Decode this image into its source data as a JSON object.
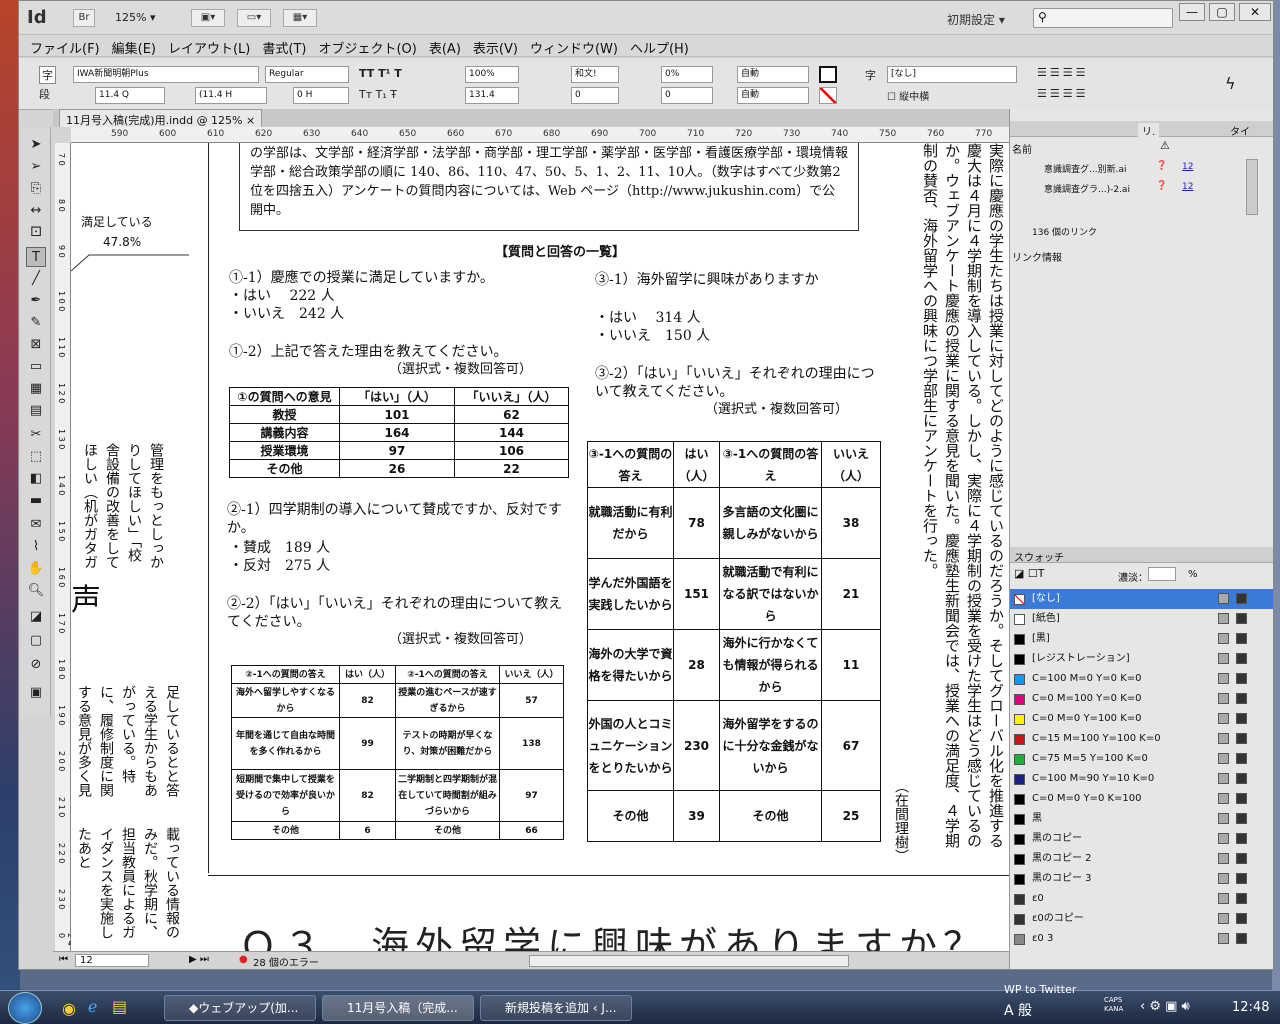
{
  "app": {
    "logo": "Id",
    "bridge": "Br",
    "zoom": "125%",
    "workspace": "初期設定",
    "window_buttons": [
      "—",
      "▢",
      "✕"
    ]
  },
  "menu": [
    "ファイル(F)",
    "編集(E)",
    "レイアウト(L)",
    "書式(T)",
    "オブジェクト(O)",
    "表(A)",
    "表示(V)",
    "ウィンドウ(W)",
    "ヘルプ(H)"
  ],
  "control": {
    "char_icon": "字",
    "para_icon": "段",
    "font": "IWA新聞明朝Plus",
    "style": "Regular",
    "size": "11.4 Q",
    "leading": "(11.4 H",
    "baseline": "0 H",
    "hscale": "100%",
    "vscale": "131.4",
    "tracking_lang": "和文!",
    "tsume": "0%",
    "kerning": "0",
    "spacing": "0",
    "auto1": "自動",
    "auto2": "自動",
    "style_none": "[なし]",
    "tate": "縦中横"
  },
  "doc_tab": "11月号入稿(完成)用.indd @ 125%",
  "ruler_h": [
    "590",
    "600",
    "610",
    "620",
    "630",
    "640",
    "650",
    "660",
    "670",
    "680",
    "690",
    "700",
    "710",
    "720",
    "730",
    "740",
    "750",
    "760",
    "770"
  ],
  "ruler_v": [
    "7 0",
    "8 0",
    "9 0",
    "1 0 0",
    "1 1 0",
    "1 2 0",
    "1 3 0",
    "1 4 0",
    "1 5 0",
    "1 6 0",
    "1 7 0",
    "1 8 0",
    "1 9 0",
    "2 0 0",
    "2 1 0",
    "2 2 0",
    "2 3 0",
    "2 4 0"
  ],
  "status": {
    "page": "12",
    "errors": "28 個のエラー"
  },
  "canvas": {
    "left_chart_label": "満足している",
    "left_chart_pct": "47.8%",
    "left_vertical_1": "管理をもっとしっかりしてほしい」「校舎設備の改善をしてほしい（机がガタガ",
    "left_big": "声",
    "left_vertical_2": "足しているとと答える学生からもあがっている。特に、履修制度に関する意見が多く見られた。入学時の",
    "left_vertical_3": "載っている情報のみだ。秋学期に、担当教員によるガイダンスを実施したあと",
    "box_text": "の学部は、文学部・経済学部・法学部・商学部・理工学部・薬学部・医学部・看護医療学部・環境情報学部・総合政策学部の順に 140、86、110、47、50、5、1、2、11、10人。（数字はすべて少数第2位を四捨五入）アンケートの質問内容については、Web ページ（http://www.jukushin.com）で公開中。",
    "section_title": "【質問と回答の一覧】",
    "q1_1": "①-1）慶應での授業に満足していますか。",
    "q1_1_yes": "・はい　 222 人",
    "q1_1_no": "・いいえ　242 人",
    "q1_2": "①-2）上記で答えた理由を教えてください。",
    "q1_2_note": "（選択式・複数回答可）",
    "t1_head": [
      "①の質問への意見",
      "「はい」（人）",
      "「いいえ」（人）"
    ],
    "t1_rows": [
      [
        "教授",
        "101",
        "62"
      ],
      [
        "講義内容",
        "164",
        "144"
      ],
      [
        "授業環境",
        "97",
        "106"
      ],
      [
        "その他",
        "26",
        "22"
      ]
    ],
    "q2_1": "②-1）四学期制の導入について賛成ですか、反対ですか。",
    "q2_1_yes": "・賛成　189 人",
    "q2_1_no": "・反対　275 人",
    "q2_2": "②-2）「はい」「いいえ」それぞれの理由について教えてください。",
    "q2_2_note": "（選択式・複数回答可）",
    "t2_head": [
      "②-1への質問の答え",
      "はい（人）",
      "②-1への質問の答え",
      "いいえ（人）"
    ],
    "t2_rows": [
      [
        "海外へ留学しやすくなるから",
        "82",
        "授業の進むペースが速すぎるから",
        "57"
      ],
      [
        "年間を通じて自由な時間を多く作れるから",
        "99",
        "テストの時期が早くなり、対策が困難だから",
        "138"
      ],
      [
        "短期間で集中して授業を受けるので効率が良いから",
        "82",
        "二学期制と四学期制が混在していて時間割が組みづらいから",
        "97"
      ],
      [
        "その他",
        "6",
        "その他",
        "66"
      ]
    ],
    "q3_1": "③-1）海外留学に興味がありますか",
    "q3_1_yes": "・はい　 314 人",
    "q3_1_no": "・いいえ　150 人",
    "q3_2": "③-2）「はい」「いいえ」それぞれの理由について教えてください。",
    "q3_2_note": "（選択式・複数回答可）",
    "t3_head": [
      "③-1への質問の答え",
      "はい（人）",
      "③-1への質問の答え",
      "いいえ（人）"
    ],
    "t3_rows": [
      [
        "就職活動に有利だから",
        "78",
        "多言語の文化圏に親しみがないから",
        "38"
      ],
      [
        "学んだ外国語を実践したいから",
        "151",
        "就職活動で有利になる訳ではないから",
        "21"
      ],
      [
        "海外の大学で資格を得たいから",
        "28",
        "海外に行かなくても情報が得られるから",
        "11"
      ],
      [
        "外国の人とコミュニケーションをとりたいから",
        "230",
        "海外留学をするのに十分な金銭がないから",
        "67"
      ],
      [
        "その他",
        "39",
        "その他",
        "25"
      ]
    ],
    "right_vertical": "実際に慶應の学生たちは授業に対してどのように感じているのだろうか。そしてグローバル化を推進する慶大は４月に４学期制を導入している。しかし、実際に４学期制の授業を受けた学生はどう感じているのか。ウェブアンケート慶應の授業に関する意見を聞いた。慶應塾生新聞会では、授業への満足度、４学期制の賛否、海外留学への興味につ学部生にアンケートを行った。",
    "byline": "（在間理樹）",
    "bottom_heading": "Ｑ３．海外留学に興味がありますか？"
  },
  "links_panel": {
    "tabs": [
      "リ.",
      "タイ"
    ],
    "col_name": "名前",
    "items": [
      {
        "name": "意識調査グ...別新.ai",
        "page": "12"
      },
      {
        "name": "意識調査グラ...)-2.ai",
        "page": "12"
      }
    ],
    "count": "136 個のリンク",
    "info": "リンク情報"
  },
  "swatches": {
    "title": "スウォッチ",
    "tint_label": "濃淡：",
    "tint_unit": "%",
    "items": [
      {
        "name": "[なし]",
        "color": "#ffffff"
      },
      {
        "name": "[紙色]",
        "color": "#ffffff"
      },
      {
        "name": "[黒]",
        "color": "#000000"
      },
      {
        "name": "[レジストレーション]",
        "color": "#000000"
      },
      {
        "name": "C=100 M=0 Y=0 K=0",
        "color": "#00a0e9"
      },
      {
        "name": "C=0 M=100 Y=0 K=0",
        "color": "#e4007f"
      },
      {
        "name": "C=0 M=0 Y=100 K=0",
        "color": "#fff100"
      },
      {
        "name": "C=15 M=100 Y=100 K=0",
        "color": "#d0121b"
      },
      {
        "name": "C=75 M=5 Y=100 K=0",
        "color": "#22ac38"
      },
      {
        "name": "C=100 M=90 Y=10 K=0",
        "color": "#1d2088"
      },
      {
        "name": "C=0 M=0 Y=0 K=100",
        "color": "#000000"
      },
      {
        "name": "黒",
        "color": "#000000"
      },
      {
        "name": "黒のコピー",
        "color": "#000000"
      },
      {
        "name": "黒のコピー 2",
        "color": "#000000"
      },
      {
        "name": "黒のコピー 3",
        "color": "#000000"
      },
      {
        "name": "ε0",
        "color": "#333333"
      },
      {
        "name": "ε0のコピー",
        "color": "#333333"
      },
      {
        "name": "ε0 3",
        "color": "#888888"
      }
    ]
  },
  "taskbar": {
    "tasks": [
      "◆ウェブアップ(加...",
      "11月号入稿（完成...",
      "新規投稿を追加 ‹ J..."
    ],
    "clock": "12:48",
    "ime": "A 般",
    "caps": "CAPS KANA",
    "twitter": "WP to Twitter"
  }
}
